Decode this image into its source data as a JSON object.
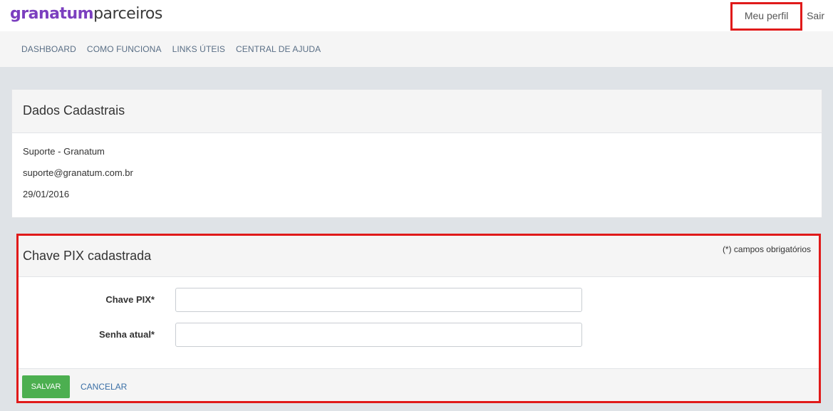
{
  "header": {
    "logo_brand": "granatum",
    "logo_suffix": "parceiros",
    "profile_label": "Meu perfil",
    "logout_label": "Sair"
  },
  "nav": {
    "items": [
      {
        "label": "DASHBOARD"
      },
      {
        "label": "COMO FUNCIONA"
      },
      {
        "label": "LINKS ÚTEIS"
      },
      {
        "label": "CENTRAL DE AJUDA"
      }
    ]
  },
  "registration": {
    "title": "Dados Cadastrais",
    "name": "Suporte - Granatum",
    "email": "suporte@granatum.com.br",
    "date": "29/01/2016"
  },
  "pix": {
    "title": "Chave PIX cadastrada",
    "required_note": "(*) campos obrigatórios",
    "fields": [
      {
        "label": "Chave PIX*",
        "value": "",
        "placeholder": ""
      },
      {
        "label": "Senha atual*",
        "value": "",
        "placeholder": ""
      }
    ],
    "save_label": "SALVAR",
    "cancel_label": "CANCELAR"
  },
  "colors": {
    "brand": "#7b3fbf",
    "highlight": "#e01a1a",
    "save_button": "#4caf50",
    "link": "#3a6fa6"
  }
}
